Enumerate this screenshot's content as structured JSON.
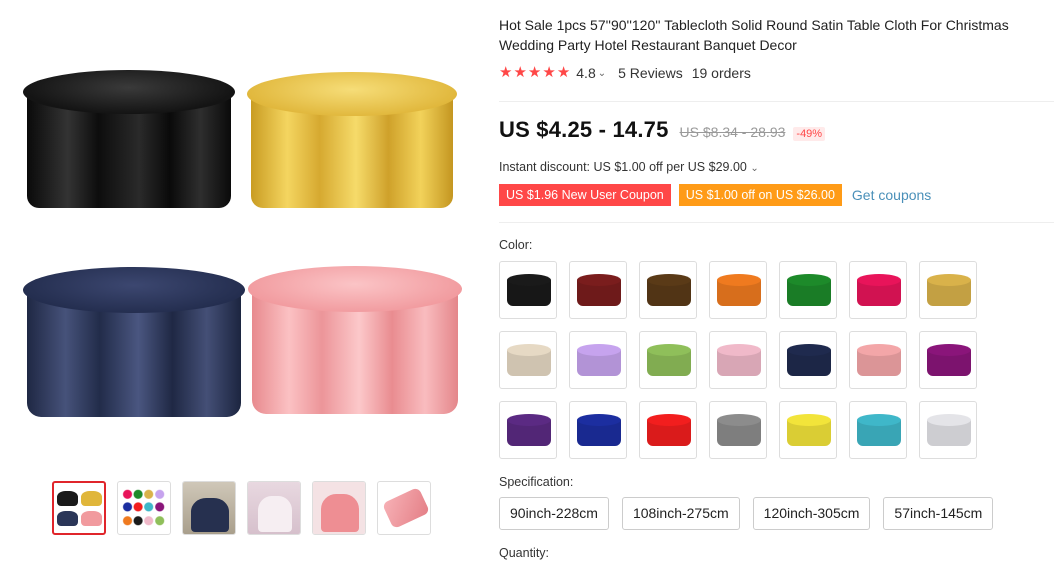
{
  "product": {
    "title": "Hot Sale 1pcs 57''90''120'' Tablecloth Solid Round Satin Table Cloth For Christmas Wedding Party Hotel Restaurant Banquet Decor"
  },
  "rating": {
    "value": "4.8",
    "reviews": "5 Reviews",
    "orders": "19 orders",
    "stars": 5
  },
  "price": {
    "current": "US $4.25 - 14.75",
    "original": "US $8.34 - 28.93",
    "discount": "-49%"
  },
  "instant_discount": "Instant discount: US $1.00 off per US $29.00",
  "coupons": {
    "new_user": "US $1.96 New User Coupon",
    "store": "US $1.00 off on US $26.00",
    "get": "Get coupons"
  },
  "labels": {
    "color": "Color:",
    "specification": "Specification:",
    "quantity": "Quantity:"
  },
  "colors": [
    "#1a1a1a",
    "#7a1d1d",
    "#5a3a17",
    "#ef7a1f",
    "#1d8a2a",
    "#e8145a",
    "#d9b24a",
    "#e6d9c4",
    "#c6a3ee",
    "#8fbf5a",
    "#f0b9c9",
    "#1f2a4e",
    "#f3a6a8",
    "#8a157a",
    "#5b2a83",
    "#1c2ea0",
    "#f21e1e",
    "#8c8c8c",
    "#f2e43a",
    "#3fb7c9",
    "#e4e4e8"
  ],
  "specifications": [
    "90inch-228cm",
    "108inch-275cm",
    "120inch-305cm",
    "57inch-145cm"
  ],
  "main_image_colors": {
    "black": "#161616",
    "gold": "#e0b63a",
    "navy": "#2b3658",
    "pink": "#f19a9e"
  },
  "thumbnails": [
    "thumb-variants",
    "thumb-color-chart",
    "thumb-navy-table",
    "thumb-white-table",
    "thumb-pink-table",
    "thumb-pink-fabric"
  ]
}
